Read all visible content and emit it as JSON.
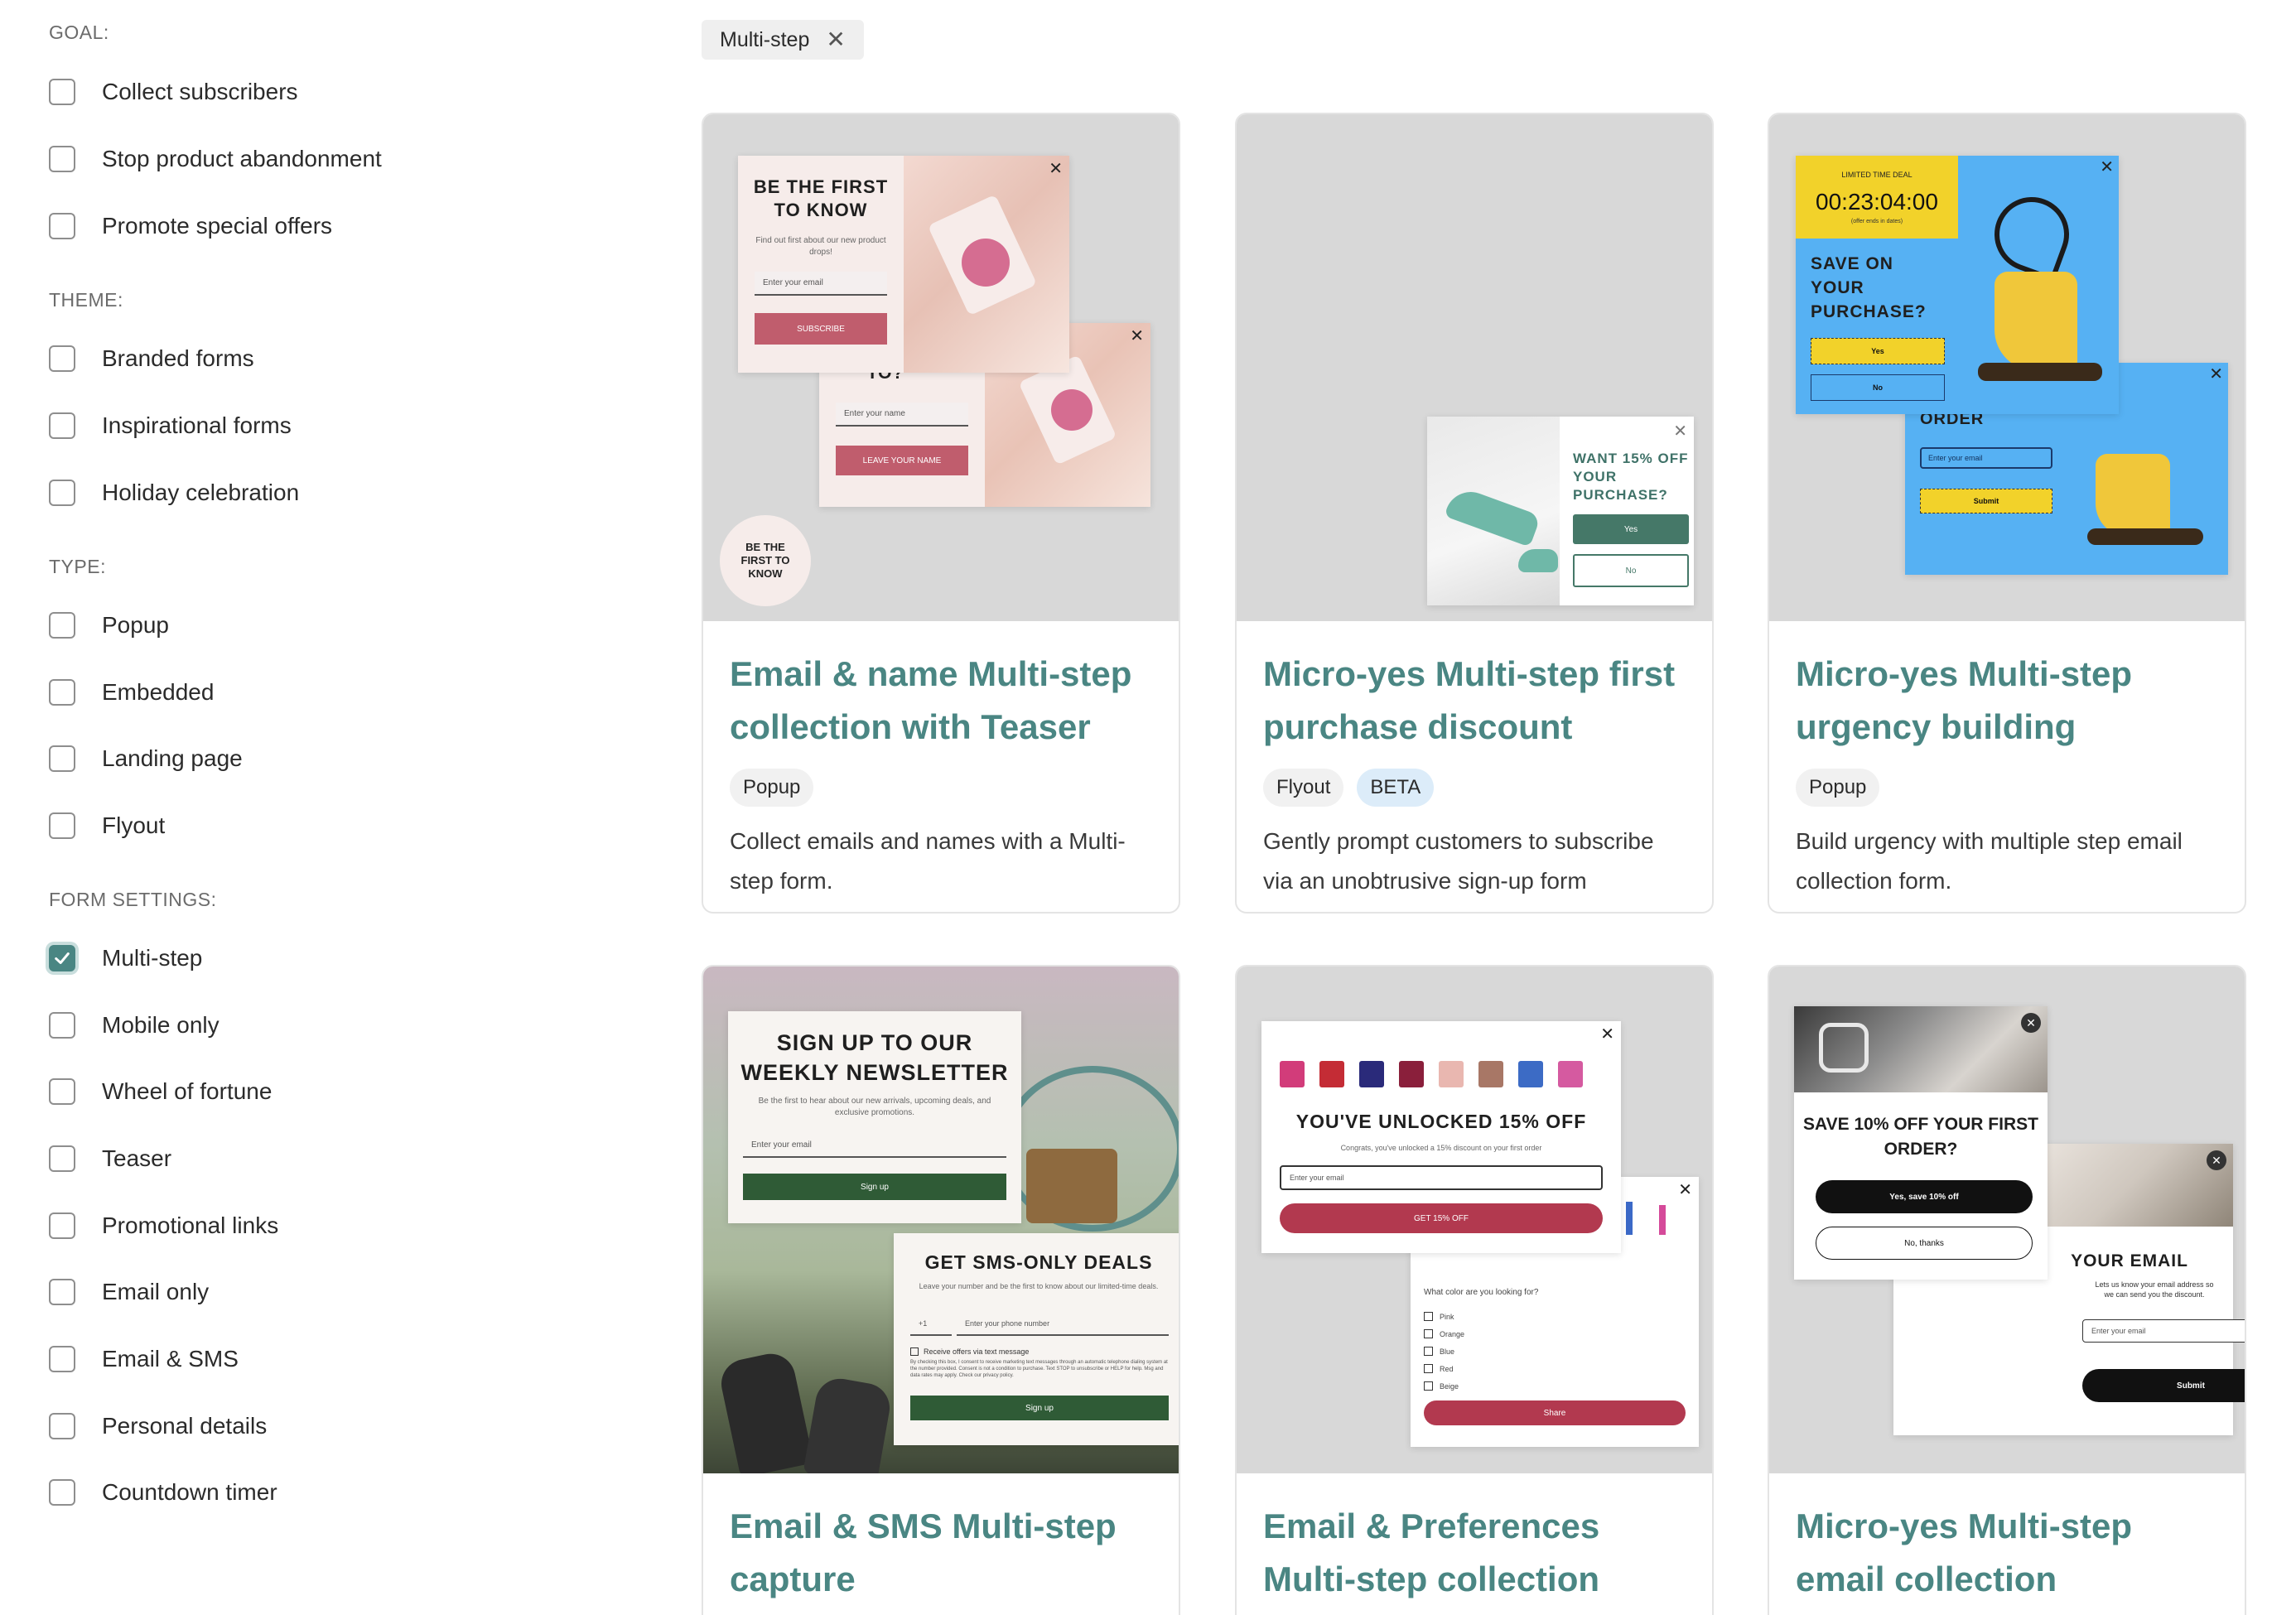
{
  "filters": {
    "groups": [
      {
        "heading": "GOAL:",
        "options": [
          {
            "label": "Collect subscribers",
            "checked": false
          },
          {
            "label": "Stop product abandonment",
            "checked": false
          },
          {
            "label": "Promote special offers",
            "checked": false
          }
        ]
      },
      {
        "heading": "THEME:",
        "options": [
          {
            "label": "Branded forms",
            "checked": false
          },
          {
            "label": "Inspirational forms",
            "checked": false
          },
          {
            "label": "Holiday celebration",
            "checked": false
          }
        ]
      },
      {
        "heading": "TYPE:",
        "options": [
          {
            "label": "Popup",
            "checked": false
          },
          {
            "label": "Embedded",
            "checked": false
          },
          {
            "label": "Landing page",
            "checked": false
          },
          {
            "label": "Flyout",
            "checked": false
          }
        ]
      },
      {
        "heading": "FORM SETTINGS:",
        "options": [
          {
            "label": "Multi-step",
            "checked": true
          },
          {
            "label": "Mobile only",
            "checked": false
          },
          {
            "label": "Wheel of fortune",
            "checked": false
          },
          {
            "label": "Teaser",
            "checked": false
          },
          {
            "label": "Promotional links",
            "checked": false
          },
          {
            "label": "Email only",
            "checked": false
          },
          {
            "label": "Email & SMS",
            "checked": false
          },
          {
            "label": "Personal details",
            "checked": false
          },
          {
            "label": "Countdown timer",
            "checked": false
          }
        ]
      }
    ]
  },
  "active_filter": {
    "label": "Multi-step",
    "remove_icon": "close-icon"
  },
  "colors": {
    "accent": "#4a8683",
    "checkbox_checked": "#4a8683",
    "thumb_bg": "#d8d8d8"
  },
  "cards": [
    {
      "title": "Email & name Multi-step collection with Teaser",
      "tags": [
        "Popup"
      ],
      "description": "Collect emails and names with a Multi-step form.",
      "preview": {
        "heading_1": "BE THE FIRST TO KNOW",
        "text_1": "Find out first about our new product drops!",
        "input_1": "Enter your email",
        "button_1": "SUBSCRIBE",
        "heading_2": "MAKE IT OUT TO?",
        "input_2": "Enter your name",
        "button_2": "LEAVE YOUR NAME",
        "teaser": "BE THE FIRST TO KNOW"
      }
    },
    {
      "title": "Micro-yes Multi-step first purchase discount",
      "tags": [
        "Flyout",
        "BETA"
      ],
      "description": "Gently prompt customers to subscribe via an unobtrusive sign-up form",
      "preview": {
        "heading": "WANT 15% OFF YOUR PURCHASE?",
        "yes": "Yes",
        "no": "No"
      }
    },
    {
      "title": "Micro-yes Multi-step urgency building",
      "tags": [
        "Popup"
      ],
      "description": "Build urgency with multiple step email collection form.",
      "preview": {
        "deal": "LIMITED TIME DEAL",
        "timer": "00:23:04:00",
        "timer_note": "(offer ends in dates)",
        "heading_1": "SAVE ON YOUR PURCHASE?",
        "yes": "Yes",
        "no": "No",
        "heading_2": "YOUR FIRST ORDER",
        "input": "Enter your email",
        "submit": "Submit"
      }
    },
    {
      "title": "Email & SMS Multi-step capture",
      "tags": [],
      "description": "",
      "preview": {
        "heading_1": "SIGN UP TO OUR WEEKLY NEWSLETTER",
        "text_1": "Be the first to hear about our new arrivals, upcoming deals, and exclusive promotions.",
        "input_1": "Enter your email",
        "button_1": "Sign up",
        "heading_2": "GET SMS-ONLY DEALS",
        "text_2": "Leave your number and be the first to know about our limited-time deals.",
        "country": "+1",
        "input_2": "Enter your phone number",
        "consent": "Receive offers via text message",
        "legal": "By checking this box, I consent to receive marketing text messages through an automatic telephone dialing system at the number provided. Consent is not a condition to purchase. Text STOP to unsubscribe or HELP for help. Msg and data rates may apply. Check our privacy policy.",
        "button_2": "Sign up"
      }
    },
    {
      "title": "Email & Preferences Multi-step collection",
      "tags": [],
      "description": "",
      "preview": {
        "heading_1": "YOU'VE UNLOCKED 15% OFF",
        "text_1": "Congrats, you've unlocked a 15% discount on your first order",
        "input": "Enter your email",
        "button_1": "GET 15% OFF",
        "question": "What color are you looking for?",
        "choices": [
          "Pink",
          "Orange",
          "Blue",
          "Red",
          "Beige"
        ],
        "button_2": "Share"
      }
    },
    {
      "title": "Micro-yes Multi-step email collection",
      "tags": [],
      "description": "",
      "preview": {
        "heading_1": "SAVE 10% OFF YOUR FIRST ORDER?",
        "yes": "Yes, save 10% off",
        "no": "No, thanks",
        "heading_2": "YOUR EMAIL",
        "text_2": "Lets us know your email address so we can send you the discount.",
        "input": "Enter your email",
        "submit": "Submit"
      }
    }
  ]
}
